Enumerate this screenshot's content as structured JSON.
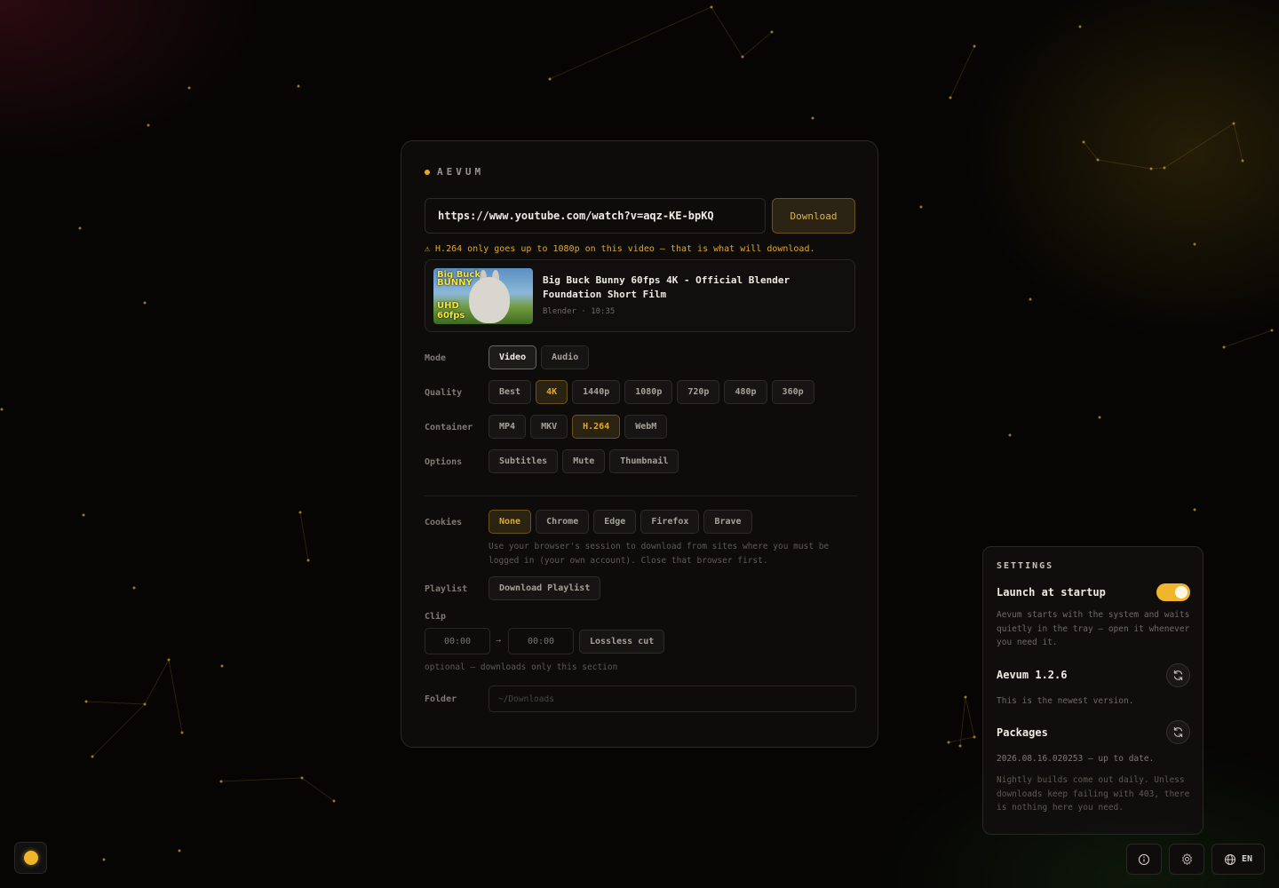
{
  "app": {
    "brand": "AEVUM"
  },
  "url": {
    "value": "https://www.youtube.com/watch?v=aqz-KE-bpKQ"
  },
  "download_button": "Download",
  "warning": "⚠ H.264 only goes up to 1080p on this video — that is what will download.",
  "video": {
    "title": "Big Buck Bunny 60fps 4K - Official Blender Foundation Short Film",
    "channel": "Blender",
    "separator": "·",
    "duration": "10:35",
    "thumb_text_top": "Big Buck BUNNY",
    "thumb_text_bottom": "UHD 60fps"
  },
  "labels": {
    "mode": "Mode",
    "quality": "Quality",
    "container": "Container",
    "options": "Options",
    "cookies": "Cookies",
    "playlist": "Playlist",
    "clip": "Clip",
    "folder": "Folder"
  },
  "mode_options": [
    {
      "label": "Video",
      "state": "selected"
    },
    {
      "label": "Audio",
      "state": ""
    }
  ],
  "quality_options": [
    {
      "label": "Best",
      "state": ""
    },
    {
      "label": "4K",
      "state": "gold"
    },
    {
      "label": "1440p",
      "state": ""
    },
    {
      "label": "1080p",
      "state": ""
    },
    {
      "label": "720p",
      "state": ""
    },
    {
      "label": "480p",
      "state": ""
    },
    {
      "label": "360p",
      "state": ""
    }
  ],
  "container_options": [
    {
      "label": "MP4",
      "state": ""
    },
    {
      "label": "MKV",
      "state": ""
    },
    {
      "label": "H.264",
      "state": "gold"
    },
    {
      "label": "WebM",
      "state": ""
    }
  ],
  "option_toggles": [
    {
      "label": "Subtitles",
      "state": ""
    },
    {
      "label": "Mute",
      "state": ""
    },
    {
      "label": "Thumbnail",
      "state": ""
    }
  ],
  "cookie_options": [
    {
      "label": "None",
      "state": "gold"
    },
    {
      "label": "Chrome",
      "state": ""
    },
    {
      "label": "Edge",
      "state": ""
    },
    {
      "label": "Firefox",
      "state": ""
    },
    {
      "label": "Brave",
      "state": ""
    }
  ],
  "cookies_hint": "Use your browser's session to download from sites where you must be logged in (your own account). Close that browser first.",
  "playlist_button": "Download Playlist",
  "clip": {
    "start_placeholder": "00:00",
    "end_placeholder": "00:00",
    "arrow": "→",
    "lossless_button": "Lossless cut",
    "hint": "optional — downloads only this section"
  },
  "folder": {
    "placeholder": "~/Downloads"
  },
  "settings": {
    "heading": "SETTINGS",
    "launch_title": "Launch at startup",
    "launch_enabled": true,
    "launch_text": "Aevum starts with the system and waits quietly in the tray — open it whenever you need it.",
    "version_title": "Aevum 1.2.6",
    "version_text": "This is the newest version.",
    "packages_title": "Packages",
    "packages_status": "2026.08.16.020253 — up to date.",
    "packages_note": "Nightly builds come out daily. Unless downloads keep failing with 403, there is nothing here you need."
  },
  "footer": {
    "language": "EN"
  },
  "colors": {
    "accent": "#f0b52a",
    "accent_text": "#e0a928",
    "background": "#060504"
  }
}
